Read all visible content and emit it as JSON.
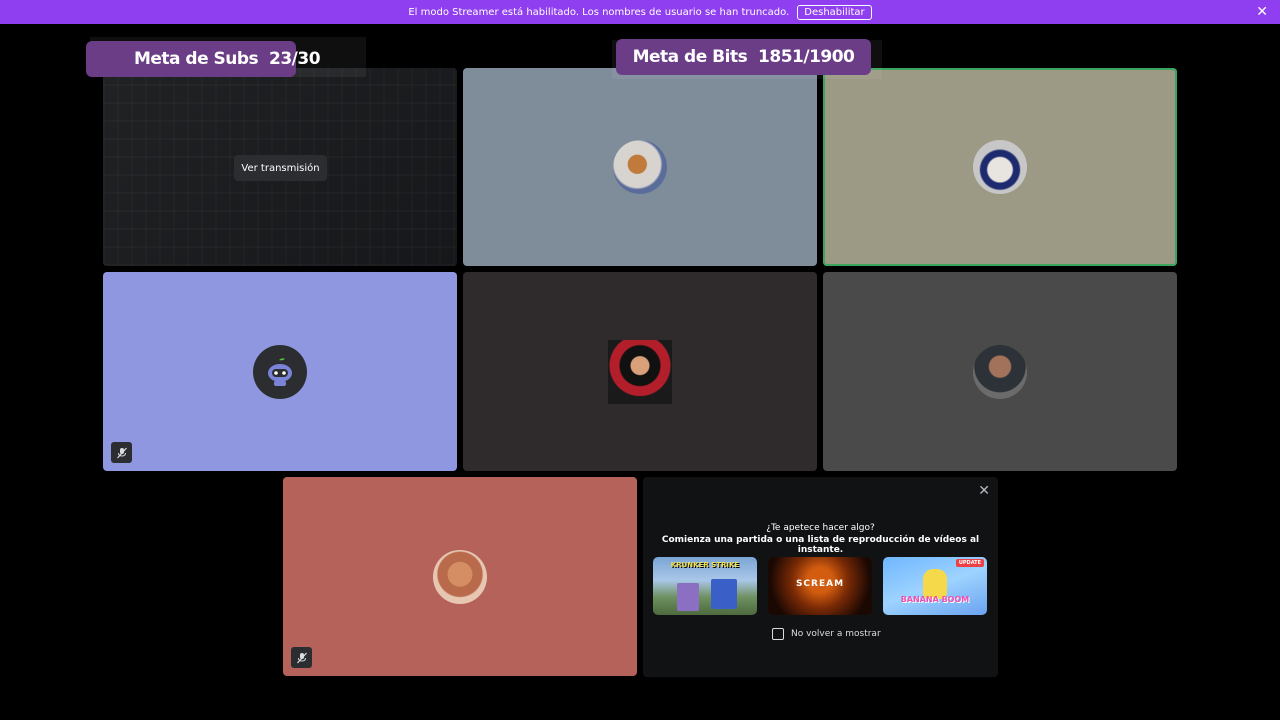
{
  "banner": {
    "message": "El modo Streamer está habilitado. Los nombres de usuario se han truncado.",
    "disable_label": "Deshabilitar",
    "close_icon": "close-icon"
  },
  "goals": {
    "subs": "Meta de Subs  23/30",
    "bits": "Meta de Bits  1851/1900"
  },
  "stream_tile": {
    "watch_label": "Ver transmisión"
  },
  "tiles": [
    {
      "id": "stream",
      "bg": "#1a1b1d"
    },
    {
      "id": "user-2",
      "bg": "#7f8c99"
    },
    {
      "id": "user-3",
      "bg": "#9c9a85",
      "speaking": true,
      "ring": "#3ba55d"
    },
    {
      "id": "user-4",
      "bg": "#8f97e0",
      "muted": true
    },
    {
      "id": "user-5",
      "bg": "#2f2b2d"
    },
    {
      "id": "user-6",
      "bg": "#4a4a4a"
    },
    {
      "id": "user-7",
      "bg": "#b4625a",
      "muted": true
    }
  ],
  "activity": {
    "question": "¿Te apetece hacer algo?",
    "subtitle": "Comienza una partida o una lista de reproducción de vídeos al instante.",
    "games": [
      {
        "title": "KRUNKER STRIKE"
      },
      {
        "title": "SCREAM"
      },
      {
        "title": "BANANA BOOM",
        "badge": "UPDATE"
      }
    ],
    "dont_show_label": "No volver a mostrar"
  },
  "colors": {
    "banner": "#8f3ff0",
    "goal": "#6a3d86",
    "speaking": "#3ba55d"
  }
}
